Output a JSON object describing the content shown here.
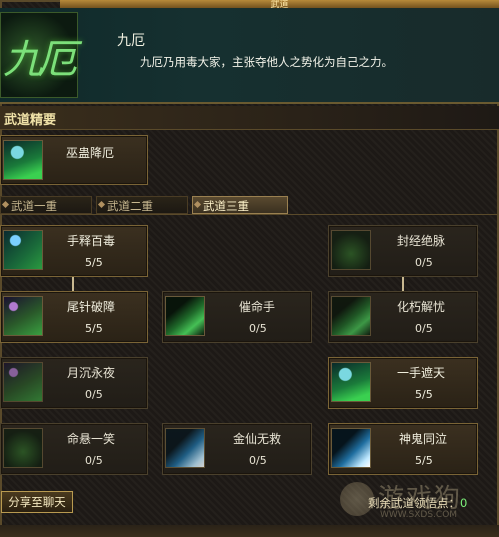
{
  "window": {
    "title": "武道"
  },
  "header": {
    "emblem_glyph": "九厄",
    "name": "九厄",
    "description": "九厄乃用毒大家，主张夺他人之势化为自己之力。"
  },
  "section": {
    "title": "武道精要"
  },
  "main_skill": {
    "label": "巫蛊降厄",
    "icon": "swirl-leaf-icon"
  },
  "tabs": [
    {
      "label": "武道一重",
      "active": false
    },
    {
      "label": "武道二重",
      "active": false
    },
    {
      "label": "武道三重",
      "active": true
    }
  ],
  "skills": [
    {
      "label": "手释百毒",
      "count": "5/5",
      "icon": "swirl-icon",
      "learned": true
    },
    {
      "label": "封经绝脉",
      "count": "0/5",
      "icon": "dark-beast-icon",
      "learned": false
    },
    {
      "label": "尾针破障",
      "count": "5/5",
      "icon": "purple-swirl-icon",
      "learned": true
    },
    {
      "label": "催命手",
      "count": "0/5",
      "icon": "blade-icon",
      "learned": false
    },
    {
      "label": "化朽解忧",
      "count": "0/5",
      "icon": "dark-blade-icon",
      "learned": false
    },
    {
      "label": "月沉永夜",
      "count": "0/5",
      "icon": "purple-dark-icon",
      "learned": false
    },
    {
      "label": "一手遮天",
      "count": "5/5",
      "icon": "swirl-leaf-icon",
      "learned": true
    },
    {
      "label": "命悬一笑",
      "count": "0/5",
      "icon": "dark-sigil-icon",
      "learned": false
    },
    {
      "label": "金仙无救",
      "count": "0/5",
      "icon": "blue-sigil-icon",
      "learned": false
    },
    {
      "label": "神鬼同泣",
      "count": "5/5",
      "icon": "blue-sigil-icon",
      "learned": true
    }
  ],
  "footer": {
    "share_label": "分享至聊天",
    "points_label": "剩余武道领悟点：",
    "points_value": "0"
  },
  "watermark": {
    "text": "游戏狗",
    "url": "WWW.SXDS.COM"
  }
}
